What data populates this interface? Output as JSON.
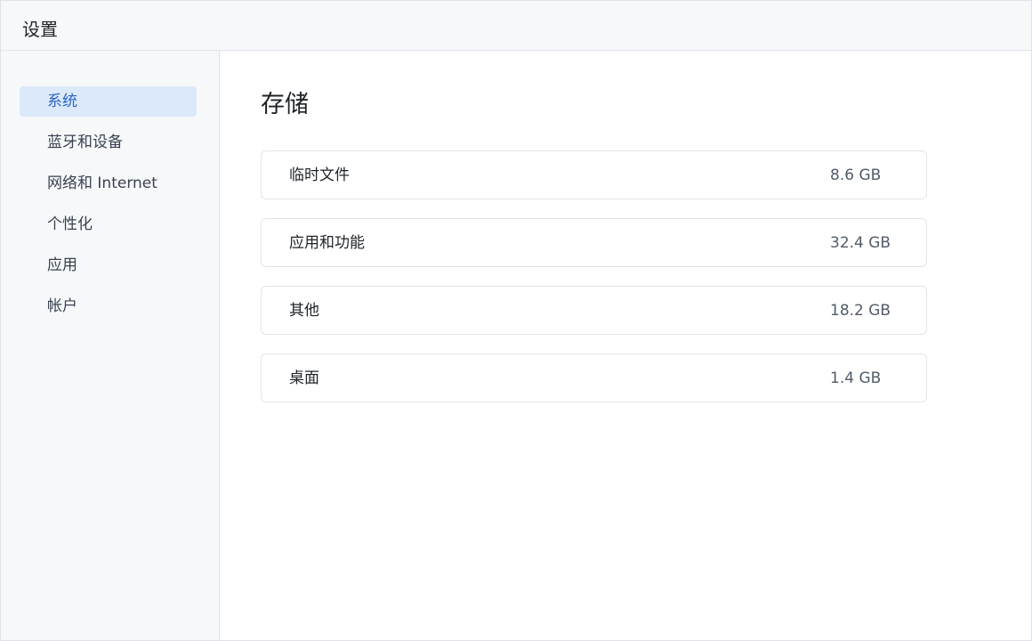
{
  "window": {
    "title": "设置"
  },
  "sidebar": {
    "items": [
      {
        "label": "系统",
        "active": true
      },
      {
        "label": "蓝牙和设备",
        "active": false
      },
      {
        "label": "网络和 Internet",
        "active": false
      },
      {
        "label": "个性化",
        "active": false
      },
      {
        "label": "应用",
        "active": false
      },
      {
        "label": "帐户",
        "active": false
      }
    ]
  },
  "main": {
    "title": "存储",
    "storage": [
      {
        "label": "临时文件",
        "size": "8.6 GB"
      },
      {
        "label": "应用和功能",
        "size": "32.4 GB"
      },
      {
        "label": "其他",
        "size": "18.2 GB"
      },
      {
        "label": "桌面",
        "size": "1.4 GB"
      }
    ]
  },
  "colors": {
    "accent": "#2a63c4",
    "active_background": "#dce9fb",
    "window_background": "#f7f8fa",
    "content_background": "#ffffff"
  }
}
